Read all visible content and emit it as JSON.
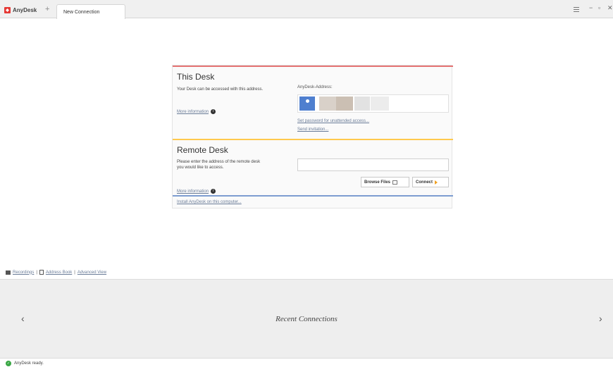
{
  "app": {
    "name": "AnyDesk",
    "new_tab_symbol": "+",
    "tab_label": "New Connection",
    "window_controls": {
      "minimize": "−",
      "restore": "▫",
      "close": "✕"
    }
  },
  "this_desk": {
    "title": "This Desk",
    "description": "Your Desk can be accessed with this address.",
    "more_info": "More information",
    "address_label": "AnyDesk-Address:",
    "set_password_link": "Set password for unattended access...",
    "send_invitation_link": "Send invitation..."
  },
  "remote_desk": {
    "title": "Remote Desk",
    "description_line1": "Please enter the address of the remote desk",
    "description_line2": "you would like to access.",
    "more_info": "More information",
    "address_input_value": "",
    "browse_button": "Browse Files",
    "connect_button": "Connect"
  },
  "install_link": "Install AnyDesk on this computer...",
  "bottom_links": {
    "recordings": "Recordings",
    "address_book": "Address Book",
    "advanced_view": "Advanced View",
    "separator": "|"
  },
  "recent": {
    "title": "Recent Connections",
    "prev": "‹",
    "next": "›"
  },
  "status": {
    "text": "AnyDesk ready."
  },
  "colors": {
    "this_desk_accent": "#e57373",
    "remote_desk_accent": "#ffc94d",
    "install_accent": "#7d9dd1",
    "logo_red": "#e53935",
    "avatar_blue": "#4f7fcf",
    "status_green": "#3aa745"
  }
}
